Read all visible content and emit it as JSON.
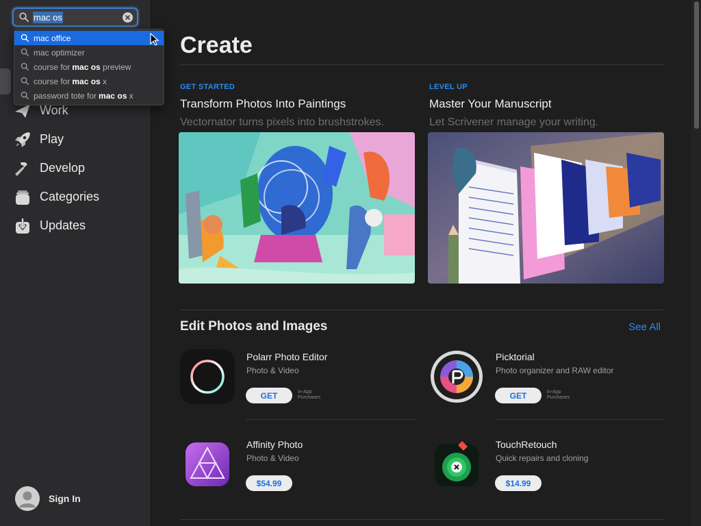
{
  "search": {
    "query": "mac os",
    "suggestions": [
      {
        "prefix": "mac office",
        "bold": "",
        "suffix": ""
      },
      {
        "prefix": "mac optimizer",
        "bold": "",
        "suffix": ""
      },
      {
        "prefix": "course for",
        "bold": "mac os",
        "suffix": " preview"
      },
      {
        "prefix": "course for",
        "bold": "mac os",
        "suffix": " x"
      },
      {
        "prefix": "password tote for",
        "bold": "mac os",
        "suffix": " x"
      }
    ]
  },
  "nav": {
    "items": [
      {
        "label": "Work",
        "icon": "paper-plane-icon"
      },
      {
        "label": "Play",
        "icon": "rocket-icon"
      },
      {
        "label": "Develop",
        "icon": "hammer-icon"
      },
      {
        "label": "Categories",
        "icon": "stack-icon"
      },
      {
        "label": "Updates",
        "icon": "download-icon"
      }
    ]
  },
  "signin": {
    "label": "Sign In"
  },
  "page": {
    "title": "Create"
  },
  "stories": [
    {
      "eyebrow": "GET STARTED",
      "headline": "Transform Photos Into Paintings",
      "subtitle": "Vectornator turns pixels into brushstrokes."
    },
    {
      "eyebrow": "LEVEL UP",
      "headline": "Master Your Manuscript",
      "subtitle": "Let Scrivener manage your writing."
    }
  ],
  "section": {
    "title": "Edit Photos and Images",
    "see_all": "See All"
  },
  "apps": [
    {
      "name": "Polarr Photo Editor",
      "category": "Photo & Video",
      "button": "GET",
      "iap": [
        "In-App",
        "Purchases"
      ]
    },
    {
      "name": "Picktorial",
      "category": "Photo organizer and RAW editor",
      "button": "GET",
      "iap": [
        "In-App",
        "Purchases"
      ]
    },
    {
      "name": "Affinity Photo",
      "category": "Photo & Video",
      "button": "$54.99",
      "iap": [
        "",
        ""
      ]
    },
    {
      "name": "TouchRetouch",
      "category": "Quick repairs and cloning",
      "button": "$14.99",
      "iap": [
        "",
        ""
      ]
    }
  ],
  "colors": {
    "accent": "#2a8cf0",
    "selection": "#1a6ae0",
    "background": "#1e1e1e",
    "sidebar": "#2b2b2d"
  }
}
